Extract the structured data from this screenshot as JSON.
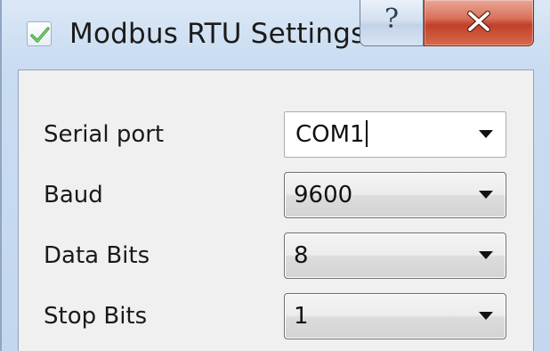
{
  "window": {
    "title": "Modbus RTU Settings",
    "help_glyph": "?",
    "close_glyph": "X"
  },
  "form": {
    "rows": [
      {
        "label": "Serial port",
        "value": "COM1",
        "editable": true
      },
      {
        "label": "Baud",
        "value": "9600",
        "editable": false
      },
      {
        "label": "Data Bits",
        "value": "8",
        "editable": false
      },
      {
        "label": "Stop Bits",
        "value": "1",
        "editable": false
      }
    ]
  },
  "icons": {
    "app": "checkmark-icon",
    "help": "help-icon",
    "close": "close-icon",
    "dropdown": "chevron-down-icon"
  },
  "colors": {
    "close_button": "#c9482f",
    "title_bar": "#c9dcf1",
    "client_bg": "#f0f0f0",
    "check_green": "#3fa63a"
  }
}
